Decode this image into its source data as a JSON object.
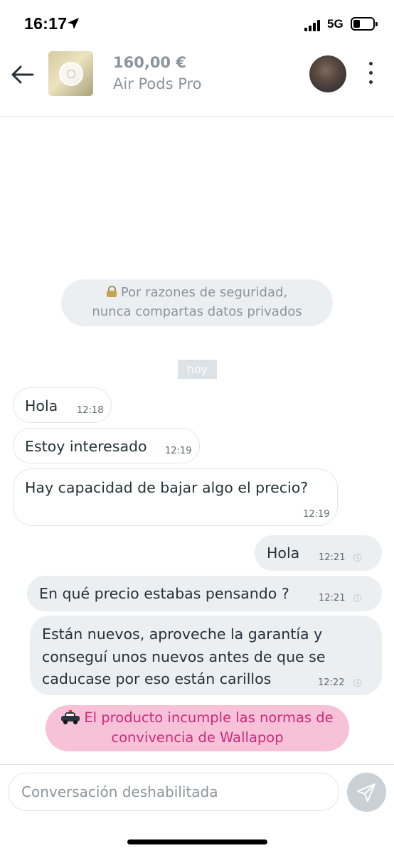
{
  "status_bar": {
    "time": "16:17",
    "network": "5G",
    "battery_level": 0.35
  },
  "header": {
    "price": "160,00 €",
    "title": "Air Pods Pro"
  },
  "security_notice": {
    "line1": "Por razones de seguridad,",
    "line2": "nunca compartas datos privados"
  },
  "date_label": "hoy",
  "messages": [
    {
      "direction": "incoming",
      "text": "Hola",
      "time": "12:18"
    },
    {
      "direction": "incoming",
      "text": "Estoy interesado",
      "time": "12:19"
    },
    {
      "direction": "incoming",
      "text": "Hay capacidad de bajar algo el precio?",
      "time": "12:19"
    },
    {
      "direction": "outgoing",
      "text": "Hola",
      "time": "12:21"
    },
    {
      "direction": "outgoing",
      "text": "En qué precio estabas pensando ?",
      "time": "12:21"
    },
    {
      "direction": "outgoing",
      "lines": [
        "Están nuevos, aproveche la garantía y",
        "conseguí unos nuevos antes de que se",
        "caducase por eso están carillos"
      ],
      "time": "12:22"
    }
  ],
  "moderation_notice": {
    "line1": "El producto incumple las normas de",
    "line2": "convivencia de Wallapop"
  },
  "composer": {
    "placeholder": "Conversación deshabilitada"
  },
  "colors": {
    "report_bg": "#f7c2d7",
    "report_text": "#cc2a7e",
    "outgoing_bubble": "#eceff1",
    "send_button": "#c9d1d6"
  }
}
